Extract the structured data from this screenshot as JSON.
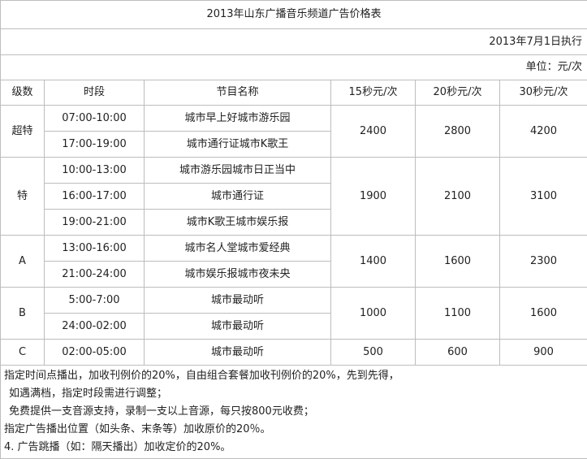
{
  "title": "2013年山东广播音乐频道广告价格表",
  "effective_date": "2013年7月1日执行",
  "unit": "单位：元/次",
  "headers": [
    "级数",
    "时段",
    "节目名称",
    "15秒元/次",
    "20秒元/次",
    "30秒元/次"
  ],
  "groups": [
    {
      "level": "超特",
      "slots": [
        {
          "time": "07:00-10:00",
          "program": "城市早上好城市游乐园"
        },
        {
          "time": "17:00-19:00",
          "program": "城市通行证城市K歌王"
        }
      ],
      "prices": [
        "2400",
        "2800",
        "4200"
      ]
    },
    {
      "level": "特",
      "slots": [
        {
          "time": "10:00-13:00",
          "program": "城市游乐园城市日正当中"
        },
        {
          "time": "16:00-17:00",
          "program": "城市通行证"
        },
        {
          "time": "19:00-21:00",
          "program": "城市K歌王城市娱乐报"
        }
      ],
      "prices": [
        "1900",
        "2100",
        "3100"
      ]
    },
    {
      "level": "A",
      "slots": [
        {
          "time": "13:00-16:00",
          "program": "城市名人堂城市爱经典"
        },
        {
          "time": "21:00-24:00",
          "program": "城市娱乐报城市夜未央"
        }
      ],
      "prices": [
        "1400",
        "1600",
        "2300"
      ]
    },
    {
      "level": "B",
      "slots": [
        {
          "time": "5:00-7:00",
          "program": "城市最动听"
        },
        {
          "time": "24:00-02:00",
          "program": "城市最动听"
        }
      ],
      "prices": [
        "1000",
        "1100",
        "1600"
      ]
    },
    {
      "level": "C",
      "slots": [
        {
          "time": "02:00-05:00",
          "program": "城市最动听"
        }
      ],
      "prices": [
        "500",
        "600",
        "900"
      ]
    }
  ],
  "notes": [
    "指定时间点播出，加收刊例价的20%，自由组合套餐加收刊例价的20%，先到先得，",
    "如遇满档，指定时段需进行调整；",
    "免费提供一支音源支持，录制一支以上音源，每只按800元收费；",
    "指定广告播出位置（如头条、末条等）加收原价的20％。",
    "4. 广告跳播（如：隔天播出）加收定价的20%。"
  ]
}
